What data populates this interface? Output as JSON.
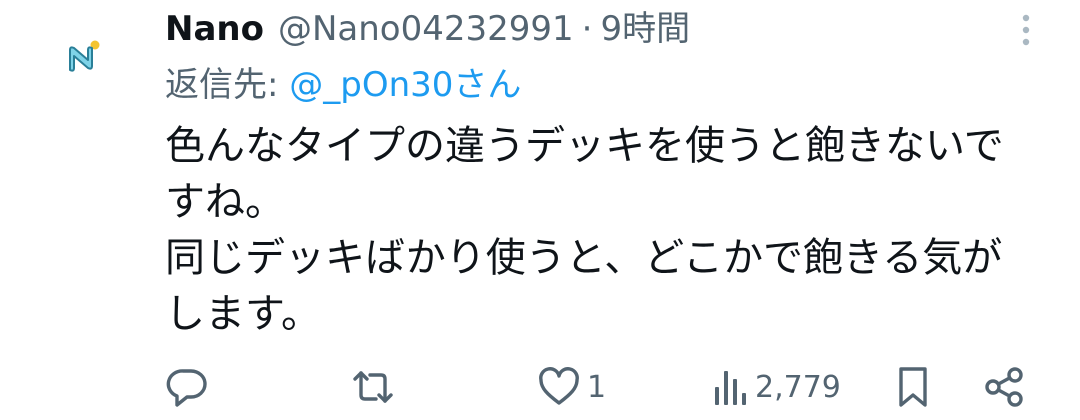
{
  "tweet": {
    "display_name": "Nano",
    "handle": "@Nano04232991",
    "separator": "·",
    "time": "9時間",
    "reply_prefix": "返信先: ",
    "reply_to": "@_pOn30さん",
    "body_lines": [
      "色んなタイプの違うデッキを使うと飽きないで",
      "すね。",
      "同じデッキばかり使うと、どこかで飽きる気が",
      "します。"
    ]
  },
  "actions": {
    "likes": "1",
    "views": "2,779"
  },
  "icons": {
    "avatar": "nano-logo-icon",
    "more": "more-vertical-icon",
    "reply": "reply-icon",
    "retweet": "retweet-icon",
    "like": "heart-icon",
    "views": "views-bar-chart-icon",
    "bookmark": "bookmark-icon",
    "share": "share-icon"
  },
  "colors": {
    "text": "#0f1419",
    "secondary": "#536471",
    "link": "#1d9bf0"
  }
}
